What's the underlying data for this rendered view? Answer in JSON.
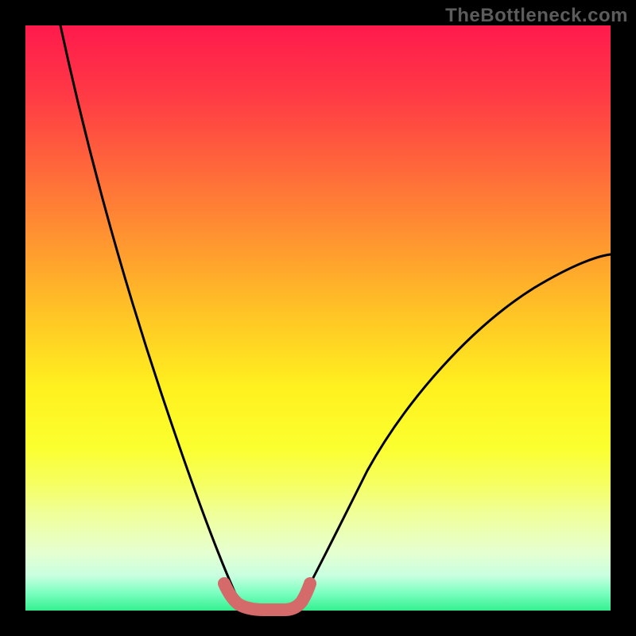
{
  "watermark": "TheBottleneck.com",
  "chart_data": {
    "type": "line",
    "title": "",
    "xlabel": "",
    "ylabel": "",
    "xlim": [
      0,
      100
    ],
    "ylim": [
      0,
      100
    ],
    "grid": false,
    "legend": false,
    "note": "Axes carry no tick labels in the image; values are normalized 0–100 as a visual estimate.",
    "series": [
      {
        "name": "left-descending-curve",
        "color": "#000000",
        "x": [
          6,
          10,
          15,
          20,
          25,
          28,
          30,
          32,
          34,
          36,
          37
        ],
        "y": [
          100,
          82,
          62,
          45,
          30,
          20,
          14,
          9,
          5,
          2,
          0
        ]
      },
      {
        "name": "right-ascending-curve",
        "color": "#000000",
        "x": [
          46,
          48,
          50,
          53,
          56,
          60,
          65,
          72,
          80,
          90,
          100
        ],
        "y": [
          0,
          2,
          5,
          9,
          14,
          20,
          27,
          35,
          43,
          52,
          60
        ]
      },
      {
        "name": "valley-marker",
        "color": "#d46a6a",
        "x": [
          34,
          36,
          38,
          40,
          42,
          44,
          46,
          48
        ],
        "y": [
          4,
          1,
          0,
          0,
          0,
          0,
          1,
          4
        ]
      }
    ]
  }
}
